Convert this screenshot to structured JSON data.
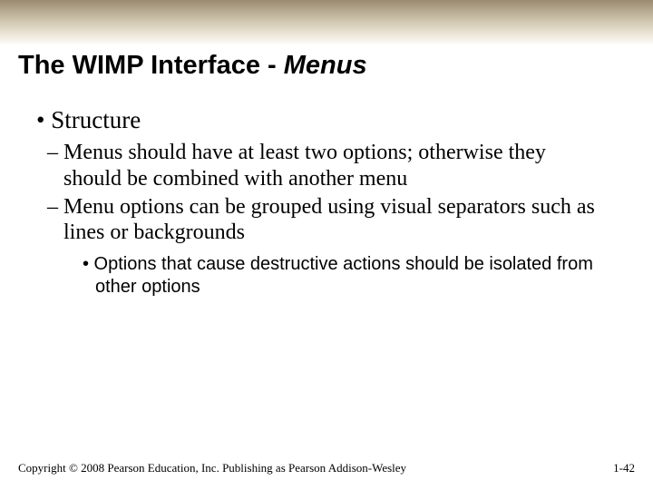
{
  "title": {
    "main": "The WIMP Interface - ",
    "italic": "Menus"
  },
  "bullets": {
    "l1": "•  Structure",
    "l2a": "– Menus should have at least two options; otherwise they should be combined with another menu",
    "l2b": "– Menu options can be grouped using visual separators such as lines or backgrounds",
    "l3": "• Options that cause destructive actions should be isolated from other options"
  },
  "footer": {
    "copyright": "Copyright © 2008 Pearson Education, Inc. Publishing as Pearson Addison-Wesley",
    "page": "1-42"
  }
}
